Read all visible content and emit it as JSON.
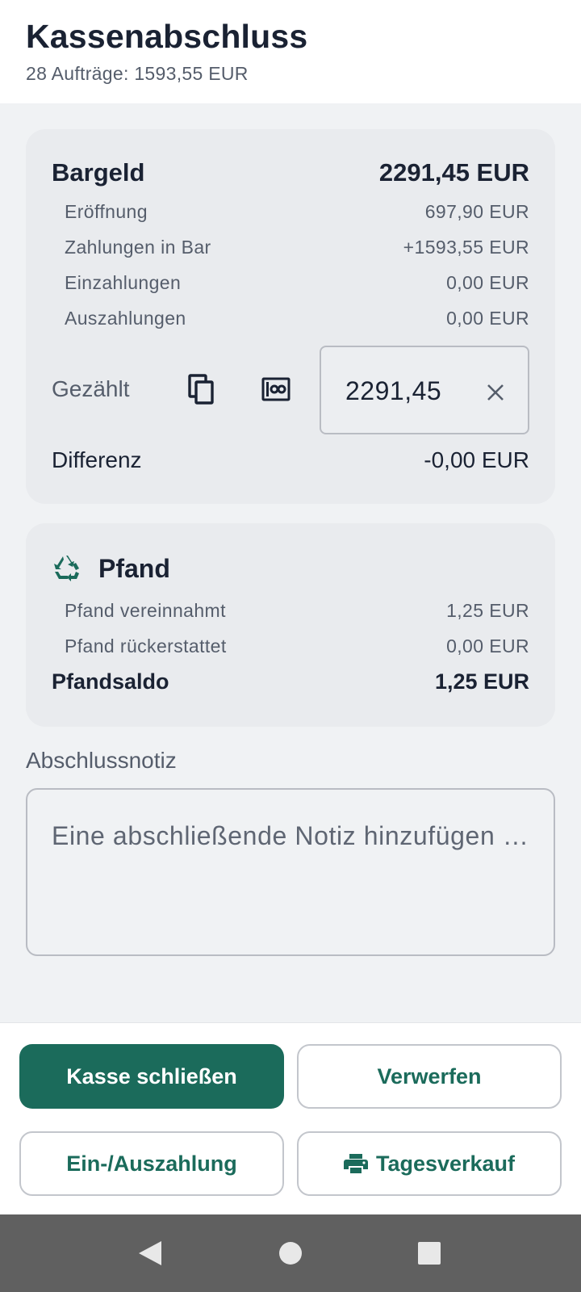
{
  "header": {
    "title": "Kassenabschluss",
    "subtitle": "28 Aufträge: 1593,55 EUR"
  },
  "cash": {
    "label": "Bargeld",
    "total": "2291,45 EUR",
    "rows": [
      {
        "label": "Eröffnung",
        "value": "697,90 EUR"
      },
      {
        "label": "Zahlungen in Bar",
        "value": "+1593,55 EUR"
      },
      {
        "label": "Einzahlungen",
        "value": "0,00 EUR"
      },
      {
        "label": "Auszahlungen",
        "value": "0,00 EUR"
      }
    ],
    "counted_label": "Gezählt",
    "counted_value": "2291,45",
    "difference_label": "Differenz",
    "difference_value": "-0,00 EUR"
  },
  "pfand": {
    "title": "Pfand",
    "rows": [
      {
        "label": "Pfand vereinnahmt",
        "value": "1,25 EUR"
      },
      {
        "label": "Pfand rückerstattet",
        "value": "0,00 EUR"
      }
    ],
    "total_label": "Pfandsaldo",
    "total_value": "1,25 EUR"
  },
  "note": {
    "label": "Abschlussnotiz",
    "placeholder": "Eine abschließende Notiz hinzufügen …"
  },
  "actions": {
    "close_register": "Kasse schließen",
    "discard": "Verwerfen",
    "cash_in_out": "Ein-/Auszahlung",
    "daily_sales": "Tagesverkauf"
  },
  "icons": {
    "copy": "copy-icon",
    "banknote": "banknote-icon",
    "clear": "close-icon",
    "recycle": "recycle-icon",
    "print": "printer-icon",
    "back": "back-icon",
    "home": "home-icon",
    "recents": "recents-icon"
  },
  "colors": {
    "accent": "#1b6b5b",
    "card": "#e9ebee",
    "background": "#f0f2f4",
    "text": "#1a2233",
    "muted": "#555d6b"
  }
}
